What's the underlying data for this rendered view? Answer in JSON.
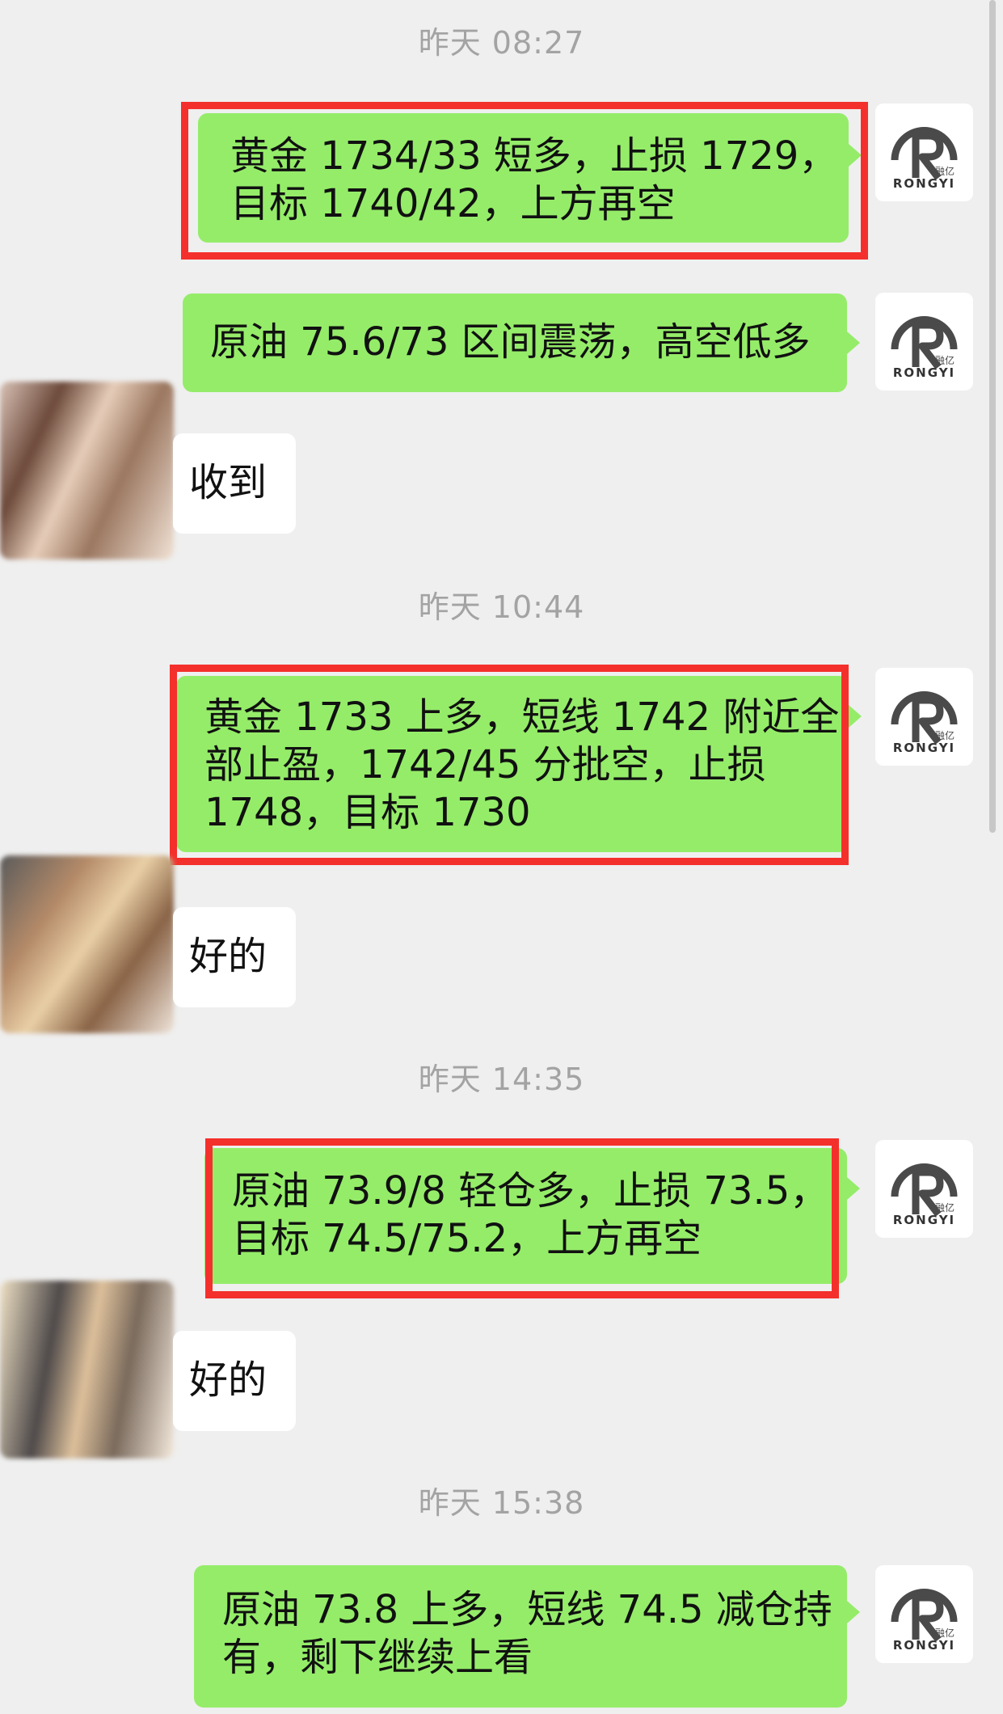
{
  "chat": {
    "sender_brand": "融亿",
    "sender_brand_latin": "RONGYI",
    "timestamps": [
      "昨天 08:27",
      "昨天 10:44",
      "昨天 14:35",
      "昨天 15:38"
    ],
    "messages": [
      {
        "lines": [
          "黄金 1734/33 短多，止损 1729，",
          "目标 1740/42，上方再空"
        ],
        "highlighted": true,
        "direction": "outgoing"
      },
      {
        "lines": [
          "原油 75.6/73 区间震荡，高空低多"
        ],
        "highlighted": false,
        "direction": "outgoing"
      },
      {
        "lines": [
          "收到"
        ],
        "highlighted": false,
        "direction": "incoming"
      },
      {
        "lines": [
          "黄金 1733 上多，短线 1742 附近全",
          "部止盈，1742/45 分批空，止损",
          "1748，目标 1730"
        ],
        "highlighted": true,
        "direction": "outgoing"
      },
      {
        "lines": [
          "好的"
        ],
        "highlighted": false,
        "direction": "incoming"
      },
      {
        "lines": [
          "原油 73.9/8 轻仓多，止损 73.5，",
          "目标 74.5/75.2，上方再空"
        ],
        "highlighted": true,
        "direction": "outgoing"
      },
      {
        "lines": [
          "好的"
        ],
        "highlighted": false,
        "direction": "incoming"
      },
      {
        "lines": [
          "原油 73.8 上多，短线 74.5 减仓持",
          "有，剩下继续上看"
        ],
        "highlighted": false,
        "direction": "outgoing"
      }
    ]
  },
  "colors": {
    "outgoing_bubble": "#95ec69",
    "incoming_bubble": "#ffffff",
    "highlight_border": "#f4302c",
    "timestamp_text": "#a3a3a3",
    "background": "#efefef"
  },
  "icons": {
    "brand_avatar": "rongyi-logo-icon",
    "user_avatar": "user-avatar-blurred"
  }
}
